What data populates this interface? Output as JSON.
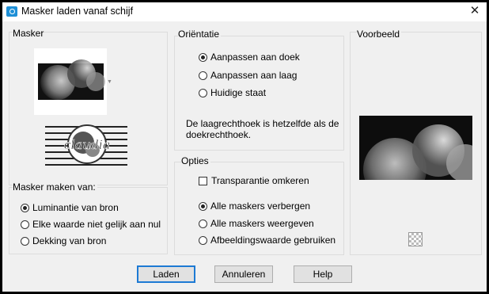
{
  "window": {
    "title": "Masker laden vanaf schijf",
    "close_label": "✕"
  },
  "mask_group": {
    "label": "Masker"
  },
  "mask_from": {
    "label": "Masker maken van:",
    "options": [
      {
        "label": "Luminantie van bron",
        "selected": true
      },
      {
        "label": "Elke waarde niet gelijk aan nul",
        "selected": false
      },
      {
        "label": "Dekking van bron",
        "selected": false
      }
    ]
  },
  "orientation": {
    "label": "Oriëntatie",
    "options": [
      {
        "label": "Aanpassen aan doek",
        "selected": true
      },
      {
        "label": "Aanpassen aan laag",
        "selected": false
      },
      {
        "label": "Huidige staat",
        "selected": false
      }
    ],
    "info": "De laagrechthoek is hetzelfde als de doekrechthoek."
  },
  "options": {
    "label": "Opties",
    "invert_transparency": {
      "label": "Transparantie omkeren",
      "checked": false
    },
    "radios": [
      {
        "label": "Alle maskers verbergen",
        "selected": true
      },
      {
        "label": "Alle maskers weergeven",
        "selected": false
      },
      {
        "label": "Afbeeldingswaarde gebruiken",
        "selected": false
      }
    ]
  },
  "preview": {
    "label": "Voorbeeld"
  },
  "logo_text": "claudia",
  "buttons": {
    "load": "Laden",
    "cancel": "Annuleren",
    "help": "Help"
  }
}
